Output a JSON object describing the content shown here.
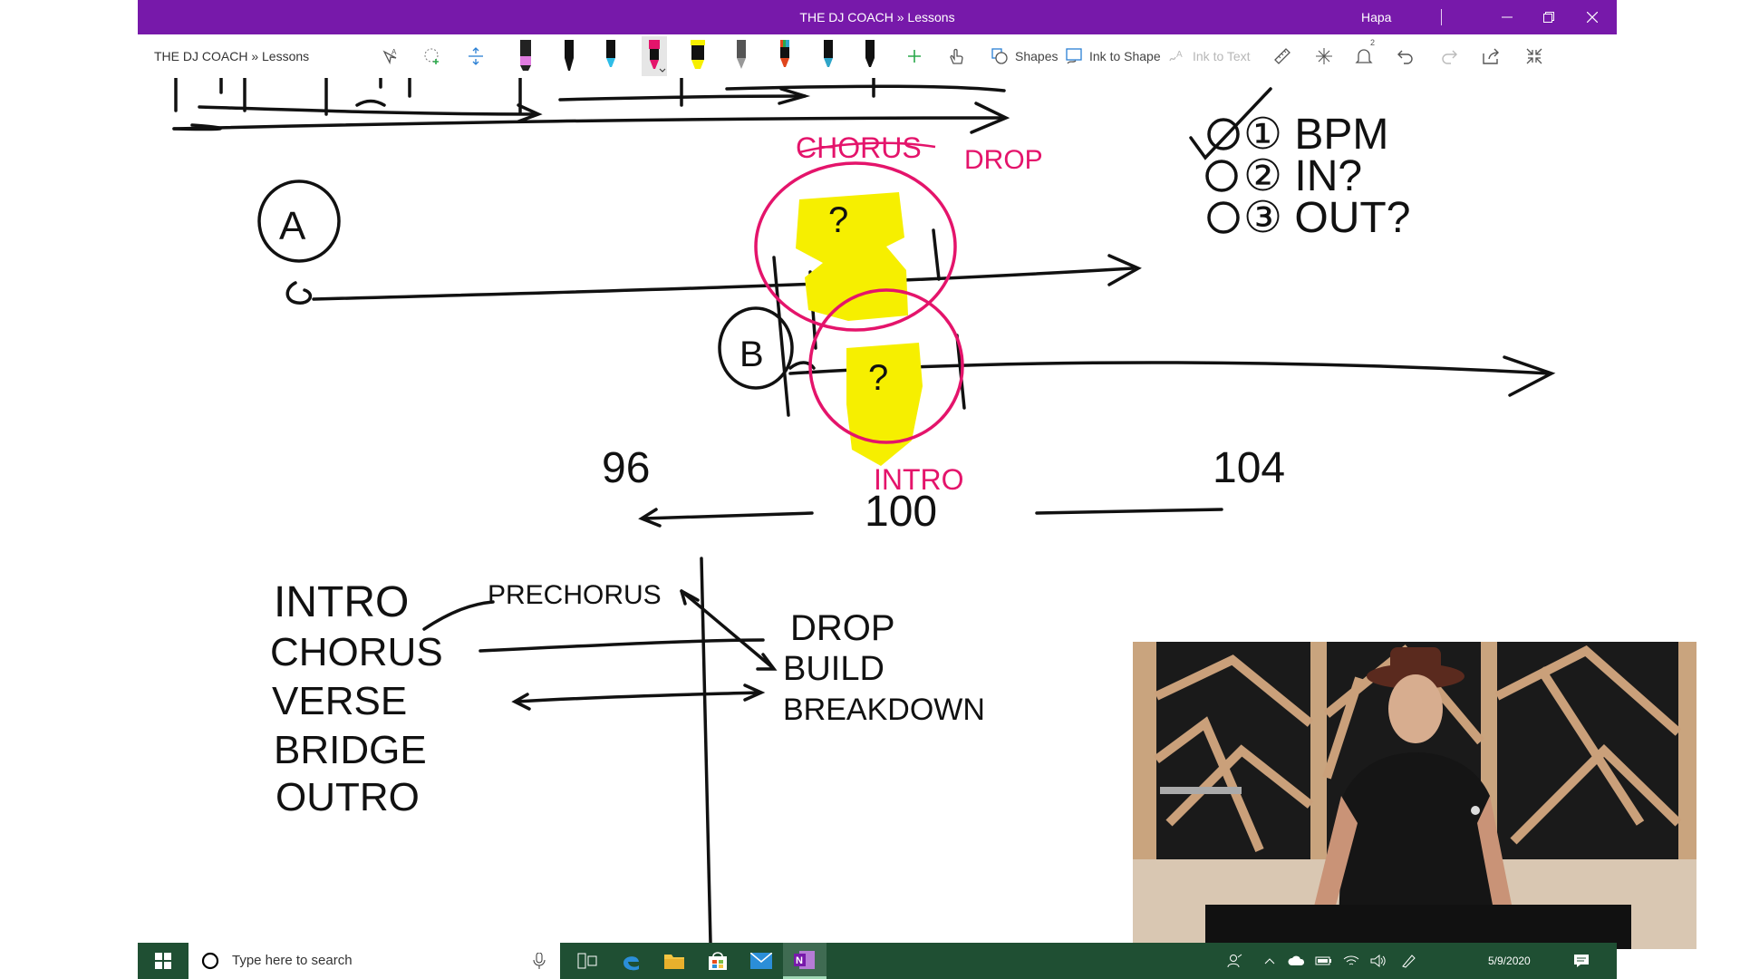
{
  "window": {
    "title": "THE DJ COACH » Lessons",
    "user": "Hapa",
    "controls": [
      "minimize",
      "restore",
      "close"
    ]
  },
  "toolbar": {
    "notebook_path": "THE DJ COACH » Lessons",
    "tools": [
      {
        "name": "lasso-select-icon"
      },
      {
        "name": "add-space-icon"
      },
      {
        "name": "insert-space-icon"
      }
    ],
    "pens": [
      {
        "color": "#111111",
        "tip": "#e07ce0"
      },
      {
        "color": "#111111",
        "tip": "#111111"
      },
      {
        "color": "#111111",
        "tip": "#2fbde8"
      },
      {
        "color": "#111111",
        "tip": "#e4146b",
        "selected": true
      },
      {
        "color": "#111111",
        "tip": "#f6ef00",
        "highlighter": true
      },
      {
        "color": "#111111",
        "tip": "#555555"
      },
      {
        "color": "#111111",
        "tip": "#e0451c"
      },
      {
        "color": "#111111",
        "tip": "#2fa5c8"
      },
      {
        "color": "#111111",
        "tip": "#111111"
      }
    ],
    "shapes_label": "Shapes",
    "ink_to_shape_label": "Ink to Shape",
    "ink_to_text_label": "Ink to Text",
    "notification_count": "2"
  },
  "canvas": {
    "handwriting": {
      "checklist": [
        "① BPM",
        "② IN?",
        "③ OUT?"
      ],
      "label_a": "A",
      "label_b": "B",
      "chorus": "CHORUS",
      "drop": "DROP",
      "intro_red": "INTRO",
      "q1": "?",
      "q2": "?",
      "bpm_low": "96",
      "bpm_mid": "100",
      "bpm_high": "104",
      "left_column": [
        "INTRO",
        "CHORUS",
        "VERSE",
        "BRIDGE",
        "OUTRO"
      ],
      "prechorus": "PRECHORUS",
      "right_column": [
        "DROP",
        "BUILD",
        "BREAKDOWN"
      ]
    },
    "ink_colors": {
      "black": "#111111",
      "pink": "#e4146b",
      "yellow": "#f6ef00"
    }
  },
  "taskbar": {
    "search_placeholder": "Type here to search",
    "apps": [
      "task-view-icon",
      "edge-icon",
      "file-explorer-icon",
      "store-icon",
      "mail-icon",
      "onenote-icon"
    ],
    "date": "5/9/2020"
  }
}
